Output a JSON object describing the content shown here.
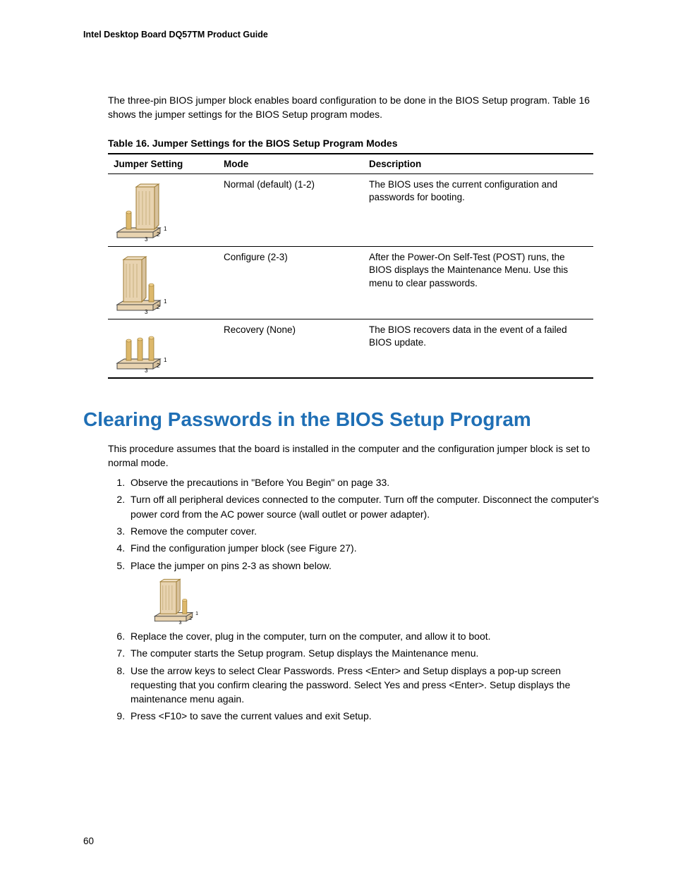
{
  "header": {
    "title": "Intel Desktop Board DQ57TM Product Guide"
  },
  "intro": "The three-pin BIOS jumper block enables board configuration to be done in the BIOS Setup program.  Table 16 shows the jumper settings for the BIOS Setup program modes.",
  "table": {
    "caption": "Table 16. Jumper Settings for the BIOS Setup Program Modes",
    "headers": {
      "setting": "Jumper Setting",
      "mode": "Mode",
      "description": "Description"
    },
    "rows": [
      {
        "mode": "Normal (default) (1-2)",
        "description": "The BIOS uses the current configuration and passwords for booting."
      },
      {
        "mode": "Configure (2-3)",
        "description": "After the Power-On Self-Test (POST) runs, the BIOS displays the Maintenance Menu.  Use this menu to clear passwords."
      },
      {
        "mode": "Recovery (None)",
        "description": "The BIOS recovers data in the event of a failed BIOS update."
      }
    ]
  },
  "section": {
    "title": "Clearing Passwords in the BIOS Setup Program",
    "intro": "This procedure assumes that the board is installed in the computer and the configuration jumper block is set to normal mode.",
    "steps": [
      "Observe the precautions in \"Before You Begin\" on page 33.",
      "Turn off all peripheral devices connected to the computer.  Turn off the computer.  Disconnect the computer's power cord from the AC power source (wall outlet or power adapter).",
      "Remove the computer cover.",
      "Find the configuration jumper block (see Figure 27).",
      "Place the jumper on pins 2-3 as shown below.",
      "Replace the cover, plug in the computer, turn on the computer, and allow it to boot.",
      "The computer starts the Setup program.  Setup displays the Maintenance menu.",
      "Use the arrow keys to select Clear Passwords.  Press <Enter> and Setup displays a pop-up screen requesting that you confirm clearing the password.  Select Yes and press <Enter>.  Setup displays the maintenance menu again.",
      "Press <F10> to save the current values and exit Setup."
    ]
  },
  "pin_labels": {
    "p1": "1",
    "p2": "2",
    "p3": "3"
  },
  "page_number": "60"
}
